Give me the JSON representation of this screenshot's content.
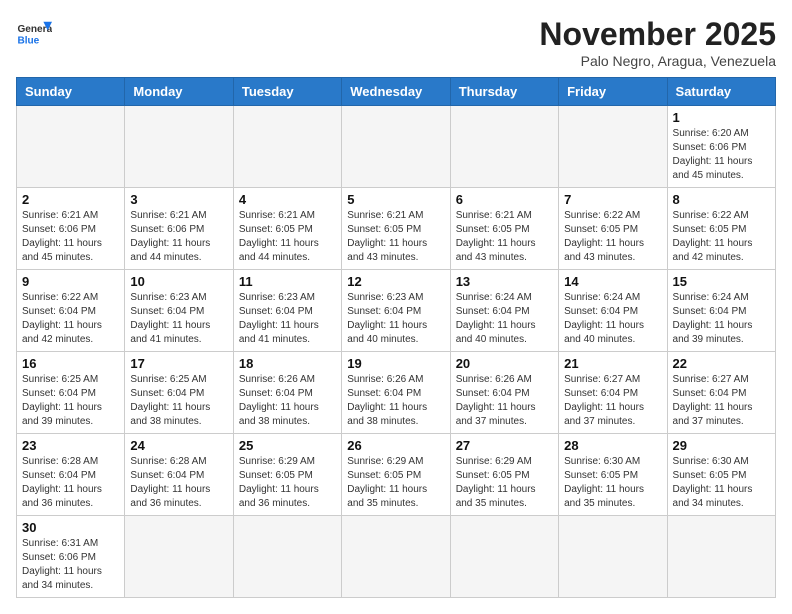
{
  "header": {
    "logo_general": "General",
    "logo_blue": "Blue",
    "title": "November 2025",
    "location": "Palo Negro, Aragua, Venezuela"
  },
  "weekdays": [
    "Sunday",
    "Monday",
    "Tuesday",
    "Wednesday",
    "Thursday",
    "Friday",
    "Saturday"
  ],
  "weeks": [
    [
      {
        "day": "",
        "info": ""
      },
      {
        "day": "",
        "info": ""
      },
      {
        "day": "",
        "info": ""
      },
      {
        "day": "",
        "info": ""
      },
      {
        "day": "",
        "info": ""
      },
      {
        "day": "",
        "info": ""
      },
      {
        "day": "1",
        "info": "Sunrise: 6:20 AM\nSunset: 6:06 PM\nDaylight: 11 hours\nand 45 minutes."
      }
    ],
    [
      {
        "day": "2",
        "info": "Sunrise: 6:21 AM\nSunset: 6:06 PM\nDaylight: 11 hours\nand 45 minutes."
      },
      {
        "day": "3",
        "info": "Sunrise: 6:21 AM\nSunset: 6:06 PM\nDaylight: 11 hours\nand 44 minutes."
      },
      {
        "day": "4",
        "info": "Sunrise: 6:21 AM\nSunset: 6:05 PM\nDaylight: 11 hours\nand 44 minutes."
      },
      {
        "day": "5",
        "info": "Sunrise: 6:21 AM\nSunset: 6:05 PM\nDaylight: 11 hours\nand 43 minutes."
      },
      {
        "day": "6",
        "info": "Sunrise: 6:21 AM\nSunset: 6:05 PM\nDaylight: 11 hours\nand 43 minutes."
      },
      {
        "day": "7",
        "info": "Sunrise: 6:22 AM\nSunset: 6:05 PM\nDaylight: 11 hours\nand 43 minutes."
      },
      {
        "day": "8",
        "info": "Sunrise: 6:22 AM\nSunset: 6:05 PM\nDaylight: 11 hours\nand 42 minutes."
      }
    ],
    [
      {
        "day": "9",
        "info": "Sunrise: 6:22 AM\nSunset: 6:04 PM\nDaylight: 11 hours\nand 42 minutes."
      },
      {
        "day": "10",
        "info": "Sunrise: 6:23 AM\nSunset: 6:04 PM\nDaylight: 11 hours\nand 41 minutes."
      },
      {
        "day": "11",
        "info": "Sunrise: 6:23 AM\nSunset: 6:04 PM\nDaylight: 11 hours\nand 41 minutes."
      },
      {
        "day": "12",
        "info": "Sunrise: 6:23 AM\nSunset: 6:04 PM\nDaylight: 11 hours\nand 40 minutes."
      },
      {
        "day": "13",
        "info": "Sunrise: 6:24 AM\nSunset: 6:04 PM\nDaylight: 11 hours\nand 40 minutes."
      },
      {
        "day": "14",
        "info": "Sunrise: 6:24 AM\nSunset: 6:04 PM\nDaylight: 11 hours\nand 40 minutes."
      },
      {
        "day": "15",
        "info": "Sunrise: 6:24 AM\nSunset: 6:04 PM\nDaylight: 11 hours\nand 39 minutes."
      }
    ],
    [
      {
        "day": "16",
        "info": "Sunrise: 6:25 AM\nSunset: 6:04 PM\nDaylight: 11 hours\nand 39 minutes."
      },
      {
        "day": "17",
        "info": "Sunrise: 6:25 AM\nSunset: 6:04 PM\nDaylight: 11 hours\nand 38 minutes."
      },
      {
        "day": "18",
        "info": "Sunrise: 6:26 AM\nSunset: 6:04 PM\nDaylight: 11 hours\nand 38 minutes."
      },
      {
        "day": "19",
        "info": "Sunrise: 6:26 AM\nSunset: 6:04 PM\nDaylight: 11 hours\nand 38 minutes."
      },
      {
        "day": "20",
        "info": "Sunrise: 6:26 AM\nSunset: 6:04 PM\nDaylight: 11 hours\nand 37 minutes."
      },
      {
        "day": "21",
        "info": "Sunrise: 6:27 AM\nSunset: 6:04 PM\nDaylight: 11 hours\nand 37 minutes."
      },
      {
        "day": "22",
        "info": "Sunrise: 6:27 AM\nSunset: 6:04 PM\nDaylight: 11 hours\nand 37 minutes."
      }
    ],
    [
      {
        "day": "23",
        "info": "Sunrise: 6:28 AM\nSunset: 6:04 PM\nDaylight: 11 hours\nand 36 minutes."
      },
      {
        "day": "24",
        "info": "Sunrise: 6:28 AM\nSunset: 6:04 PM\nDaylight: 11 hours\nand 36 minutes."
      },
      {
        "day": "25",
        "info": "Sunrise: 6:29 AM\nSunset: 6:05 PM\nDaylight: 11 hours\nand 36 minutes."
      },
      {
        "day": "26",
        "info": "Sunrise: 6:29 AM\nSunset: 6:05 PM\nDaylight: 11 hours\nand 35 minutes."
      },
      {
        "day": "27",
        "info": "Sunrise: 6:29 AM\nSunset: 6:05 PM\nDaylight: 11 hours\nand 35 minutes."
      },
      {
        "day": "28",
        "info": "Sunrise: 6:30 AM\nSunset: 6:05 PM\nDaylight: 11 hours\nand 35 minutes."
      },
      {
        "day": "29",
        "info": "Sunrise: 6:30 AM\nSunset: 6:05 PM\nDaylight: 11 hours\nand 34 minutes."
      }
    ],
    [
      {
        "day": "30",
        "info": "Sunrise: 6:31 AM\nSunset: 6:06 PM\nDaylight: 11 hours\nand 34 minutes."
      },
      {
        "day": "",
        "info": ""
      },
      {
        "day": "",
        "info": ""
      },
      {
        "day": "",
        "info": ""
      },
      {
        "day": "",
        "info": ""
      },
      {
        "day": "",
        "info": ""
      },
      {
        "day": "",
        "info": ""
      }
    ]
  ]
}
